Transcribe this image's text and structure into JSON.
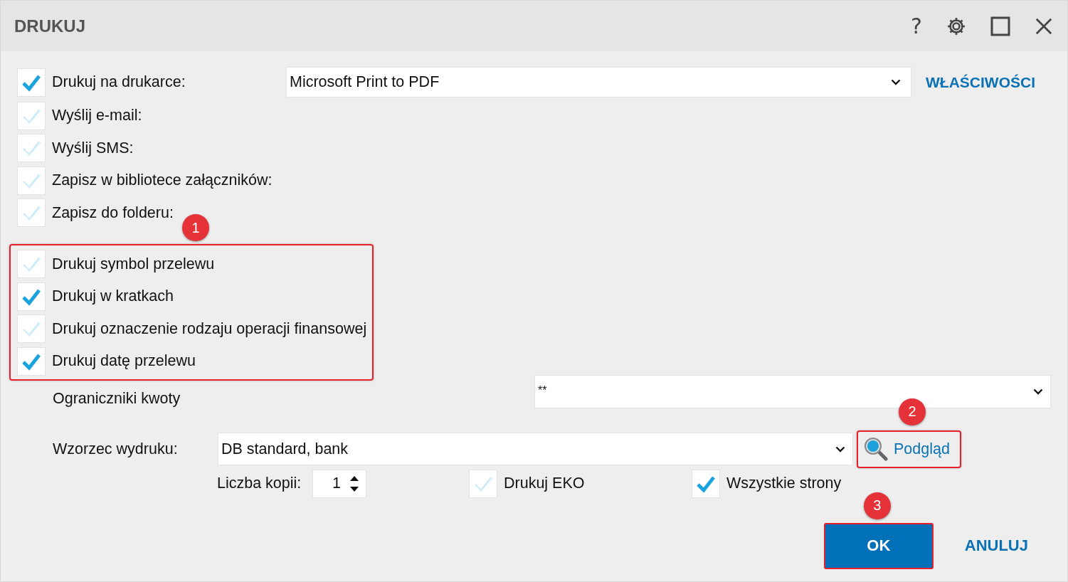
{
  "window": {
    "title": "DRUKUJ"
  },
  "title_buttons": [
    {
      "kind": "help",
      "label": "?"
    },
    {
      "kind": "settings"
    },
    {
      "kind": "maximize"
    },
    {
      "kind": "close"
    }
  ],
  "outputs": [
    {
      "label": "Drukuj na drukarce:",
      "checked": true
    },
    {
      "label": "Wyślij e-mail:",
      "checked": false
    },
    {
      "label": "Wyślij SMS:",
      "checked": false
    },
    {
      "label": "Zapisz w bibliotece załączników:",
      "checked": false
    },
    {
      "label": "Zapisz do folderu:",
      "checked": false
    }
  ],
  "printer": {
    "value": "Microsoft Print to PDF"
  },
  "properties_link": {
    "label": "WŁAŚCIWOŚCI"
  },
  "options_group": {
    "highlighted": true,
    "badge": "1",
    "items": [
      {
        "label": "Drukuj symbol przelewu",
        "checked": false
      },
      {
        "label": "Drukuj w kratkach",
        "checked": true
      },
      {
        "label": "Drukuj oznaczenie rodzaju operacji finansowej",
        "checked": false
      },
      {
        "label": "Drukuj datę przelewu",
        "checked": true
      }
    ]
  },
  "amount_delimiters": {
    "label": "Ograniczniki kwoty",
    "value": "**"
  },
  "template": {
    "label": "Wzorzec wydruku:",
    "value": "DB standard, bank"
  },
  "preview_button": {
    "label": "Podgląd",
    "highlighted": true,
    "badge": "2"
  },
  "copies": {
    "label": "Liczba kopii:",
    "value": "1"
  },
  "extra_options": [
    {
      "label": "Drukuj EKO",
      "checked": false
    },
    {
      "label": "Wszystkie strony",
      "checked": true
    }
  ],
  "ok_button": {
    "label": "OK",
    "highlighted": true,
    "badge": "3"
  },
  "cancel_button": {
    "label": "ANULUJ"
  }
}
